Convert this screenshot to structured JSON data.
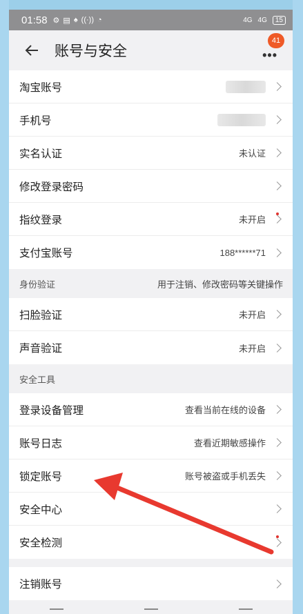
{
  "status": {
    "time": "01:58",
    "left_icons": [
      "⚙",
      "▤",
      "♠",
      "((·))",
      "◔"
    ],
    "network1": "4G",
    "network2": "4G",
    "battery": "15"
  },
  "header": {
    "title": "账号与安全",
    "badge": "41",
    "more": "•••"
  },
  "account": [
    {
      "label": "淘宝账号",
      "value": "",
      "blurred": true,
      "blurWidth": 58
    },
    {
      "label": "手机号",
      "value": "",
      "blurred": true,
      "blurWidth": 70
    },
    {
      "label": "实名认证",
      "value": "未认证"
    },
    {
      "label": "修改登录密码",
      "value": ""
    },
    {
      "label": "指纹登录",
      "value": "未开启",
      "dot": true
    },
    {
      "label": "支付宝账号",
      "value": "188******71"
    }
  ],
  "identity": {
    "title": "身份验证",
    "hint": "用于注销、修改密码等关键操作",
    "items": [
      {
        "label": "扫脸验证",
        "value": "未开启"
      },
      {
        "label": "声音验证",
        "value": "未开启"
      }
    ]
  },
  "tools": {
    "title": "安全工具",
    "items": [
      {
        "label": "登录设备管理",
        "value": "查看当前在线的设备"
      },
      {
        "label": "账号日志",
        "value": "查看近期敏感操作"
      },
      {
        "label": "锁定账号",
        "value": "账号被盗或手机丢失"
      },
      {
        "label": "安全中心",
        "value": ""
      },
      {
        "label": "安全检测",
        "value": "",
        "dot": true
      }
    ]
  },
  "cancel": {
    "label": "注销账号"
  }
}
